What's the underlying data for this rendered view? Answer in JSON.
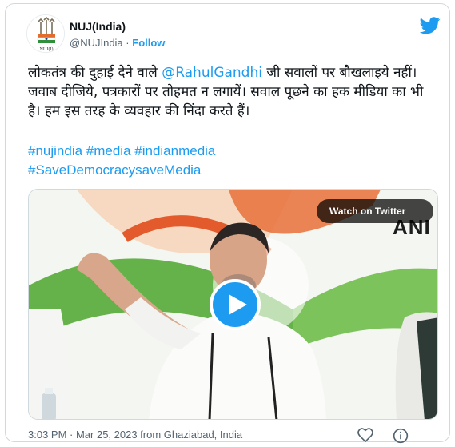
{
  "author": {
    "name": "NUJ(India)",
    "handle": "@NUJIndia",
    "follow_label": "Follow",
    "avatar_text": "NUJ(I)"
  },
  "tweet": {
    "text_line1_part1": "लोकतंत्र की दुहाई देने वाले ",
    "mention": "@RahulGandhi",
    "text_line1_part2": " जी सवालों पर",
    "text_rest": "बौखलाइये नहीं। जवाब दीजिये, पत्रकारों पर तोहमत न लगायें। सवाल पूछने का हक मीडिया का भी है। हम इस तरह के व्यवहार की निंदा करते हैं।",
    "hashtags_line1": "#nujindia #media #indianmedia",
    "hashtags_line2": "#SaveDemocracysaveMedia"
  },
  "media": {
    "watch_label": "Watch on Twitter",
    "watermark": "ANI"
  },
  "meta": {
    "timestamp": "3:03 PM · Mar 25, 2023 from Ghaziabad, India"
  },
  "colors": {
    "accent": "#1d9bf0",
    "text": "#0f1419",
    "muted": "#536471"
  },
  "icons": [
    "twitter-bird-icon",
    "play-icon",
    "heart-icon",
    "info-icon"
  ]
}
